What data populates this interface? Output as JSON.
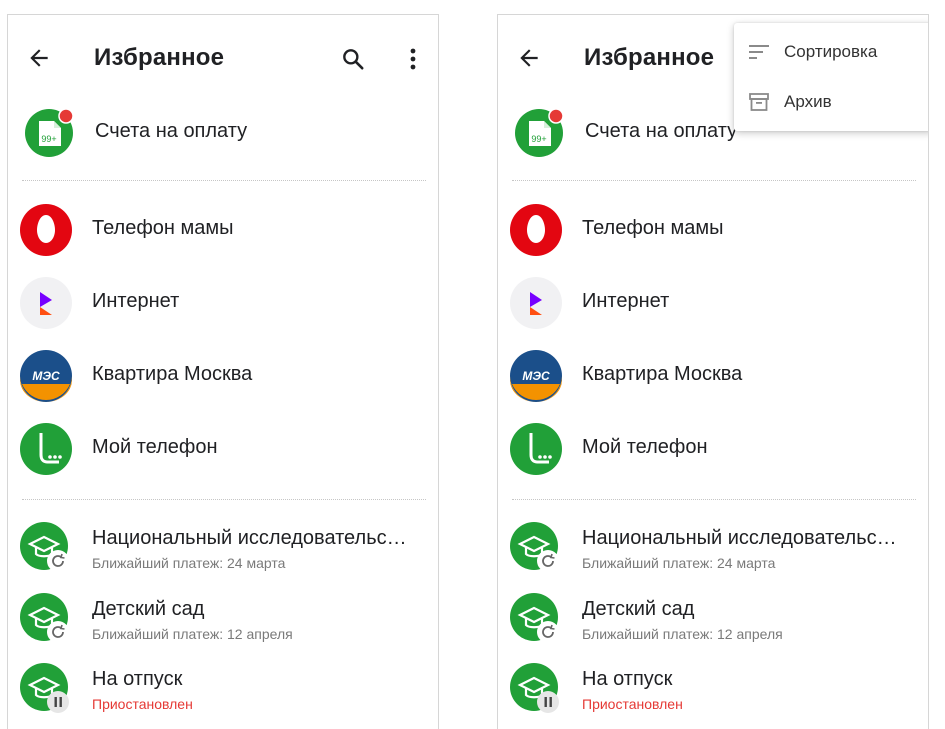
{
  "screens": [
    {
      "header": {
        "title": "Избранное"
      },
      "bills": {
        "label": "Счета на оплату",
        "badge": "99+"
      },
      "favorites": [
        {
          "label": "Телефон мамы",
          "logo": "mts-icon"
        },
        {
          "label": "Интернет",
          "logo": "rostelecom-icon"
        },
        {
          "label": "Квартира Москва",
          "logo": "mes-icon",
          "logo_text": "МЭС"
        },
        {
          "label": "Мой телефон",
          "logo": "megafon-icon"
        }
      ],
      "autopayments": [
        {
          "label": "Национальный исследовательс…",
          "status": "Ближайший платеж: 24 марта",
          "state": "active"
        },
        {
          "label": "Детский сад",
          "status": "Ближайший платеж: 12 апреля",
          "state": "active"
        },
        {
          "label": "На отпуск",
          "status": "Приостановлен",
          "state": "paused"
        }
      ]
    },
    {
      "header": {
        "title": "Избранное"
      },
      "bills": {
        "label": "Счета на оплату",
        "badge": "99+"
      },
      "favorites": [
        {
          "label": "Телефон мамы",
          "logo": "mts-icon"
        },
        {
          "label": "Интернет",
          "logo": "rostelecom-icon"
        },
        {
          "label": "Квартира Москва",
          "logo": "mes-icon",
          "logo_text": "МЭС"
        },
        {
          "label": "Мой телефон",
          "logo": "megafon-icon"
        }
      ],
      "autopayments": [
        {
          "label": "Национальный исследовательс…",
          "status": "Ближайший платеж: 24 марта",
          "state": "active"
        },
        {
          "label": "Детский сад",
          "status": "Ближайший платеж: 12 апреля",
          "state": "active"
        },
        {
          "label": "На отпуск",
          "status": "Приостановлен",
          "state": "paused"
        }
      ],
      "menu": {
        "items": [
          {
            "label": "Сортировка",
            "icon": "sort-icon"
          },
          {
            "label": "Архив",
            "icon": "archive-icon"
          }
        ]
      }
    }
  ],
  "colors": {
    "green": "#21a038",
    "mts_red": "#e30611",
    "badge_red": "#e53935",
    "rostelecom_purple": "#7700ff",
    "rostelecom_orange": "#ff4f12",
    "mes_blue": "#1b4f8a",
    "mes_orange": "#f39200"
  }
}
